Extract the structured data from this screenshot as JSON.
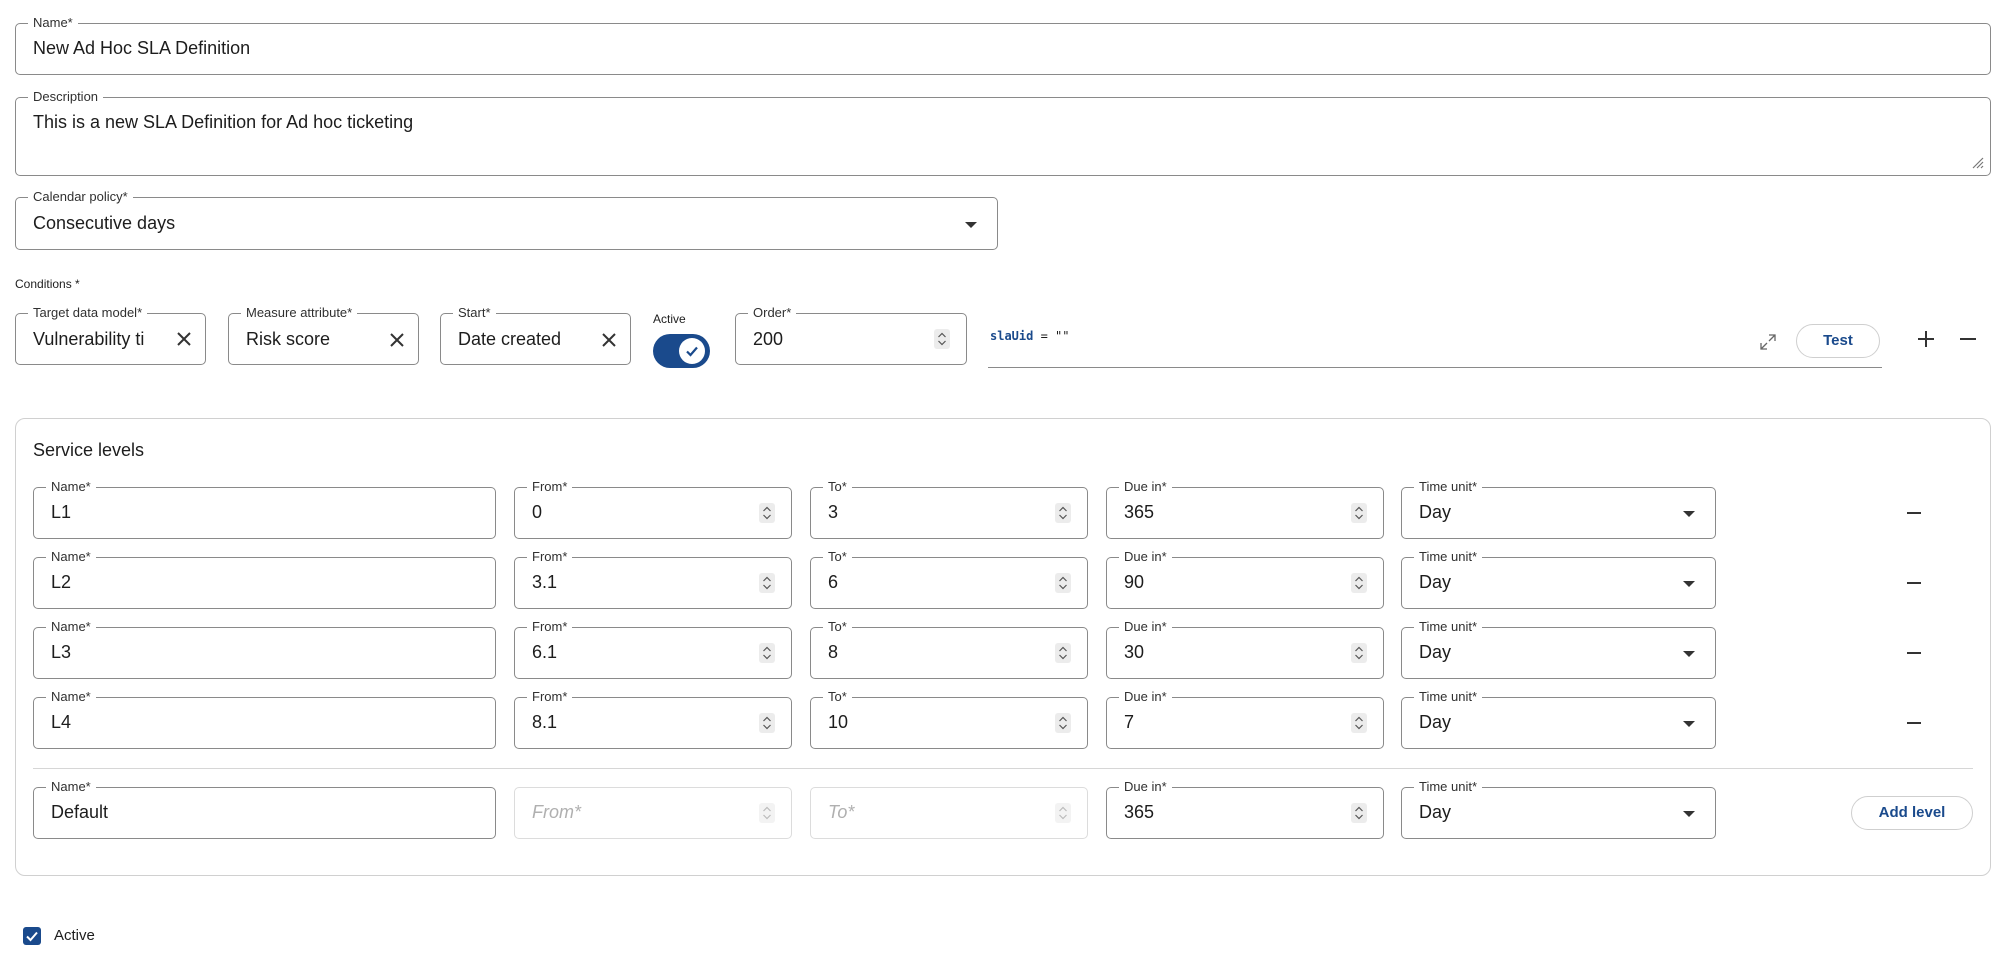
{
  "form": {
    "name": {
      "label": "Name*",
      "value": "New Ad Hoc SLA Definition"
    },
    "description": {
      "label": "Description",
      "value": "This is a new SLA Definition for Ad hoc ticketing"
    },
    "calendar_policy": {
      "label": "Calendar policy*",
      "value": "Consecutive days"
    }
  },
  "conditions": {
    "label": "Conditions *",
    "target_data_model": {
      "label": "Target data model*",
      "value": "Vulnerability ti"
    },
    "measure_attribute": {
      "label": "Measure attribute*",
      "value": "Risk score"
    },
    "start": {
      "label": "Start*",
      "value": "Date created"
    },
    "active_toggle": {
      "label": "Active",
      "on": true
    },
    "order": {
      "label": "Order*",
      "value": "200"
    },
    "expression": {
      "keyword": "slaUid",
      "operator": " = ",
      "value": "\"\""
    },
    "test_label": "Test"
  },
  "service_levels": {
    "title": "Service levels",
    "column_labels": {
      "name": "Name*",
      "from": "From*",
      "to": "To*",
      "due_in": "Due in*",
      "time_unit": "Time unit*"
    },
    "rows": [
      {
        "name": "L1",
        "from": "0",
        "to": "3",
        "due_in": "365",
        "time_unit": "Day"
      },
      {
        "name": "L2",
        "from": "3.1",
        "to": "6",
        "due_in": "90",
        "time_unit": "Day"
      },
      {
        "name": "L3",
        "from": "6.1",
        "to": "8",
        "due_in": "30",
        "time_unit": "Day"
      },
      {
        "name": "L4",
        "from": "8.1",
        "to": "10",
        "due_in": "7",
        "time_unit": "Day"
      }
    ],
    "default_row": {
      "name": "Default",
      "from_placeholder": "From*",
      "to_placeholder": "To*",
      "due_in": "365",
      "time_unit": "Day"
    },
    "add_level_label": "Add level"
  },
  "active_checkbox": {
    "label": "Active",
    "checked": true
  },
  "colors": {
    "accent": "#1a4a8c",
    "border": "#8a8a8a",
    "muted_border": "#dcdcdc"
  }
}
